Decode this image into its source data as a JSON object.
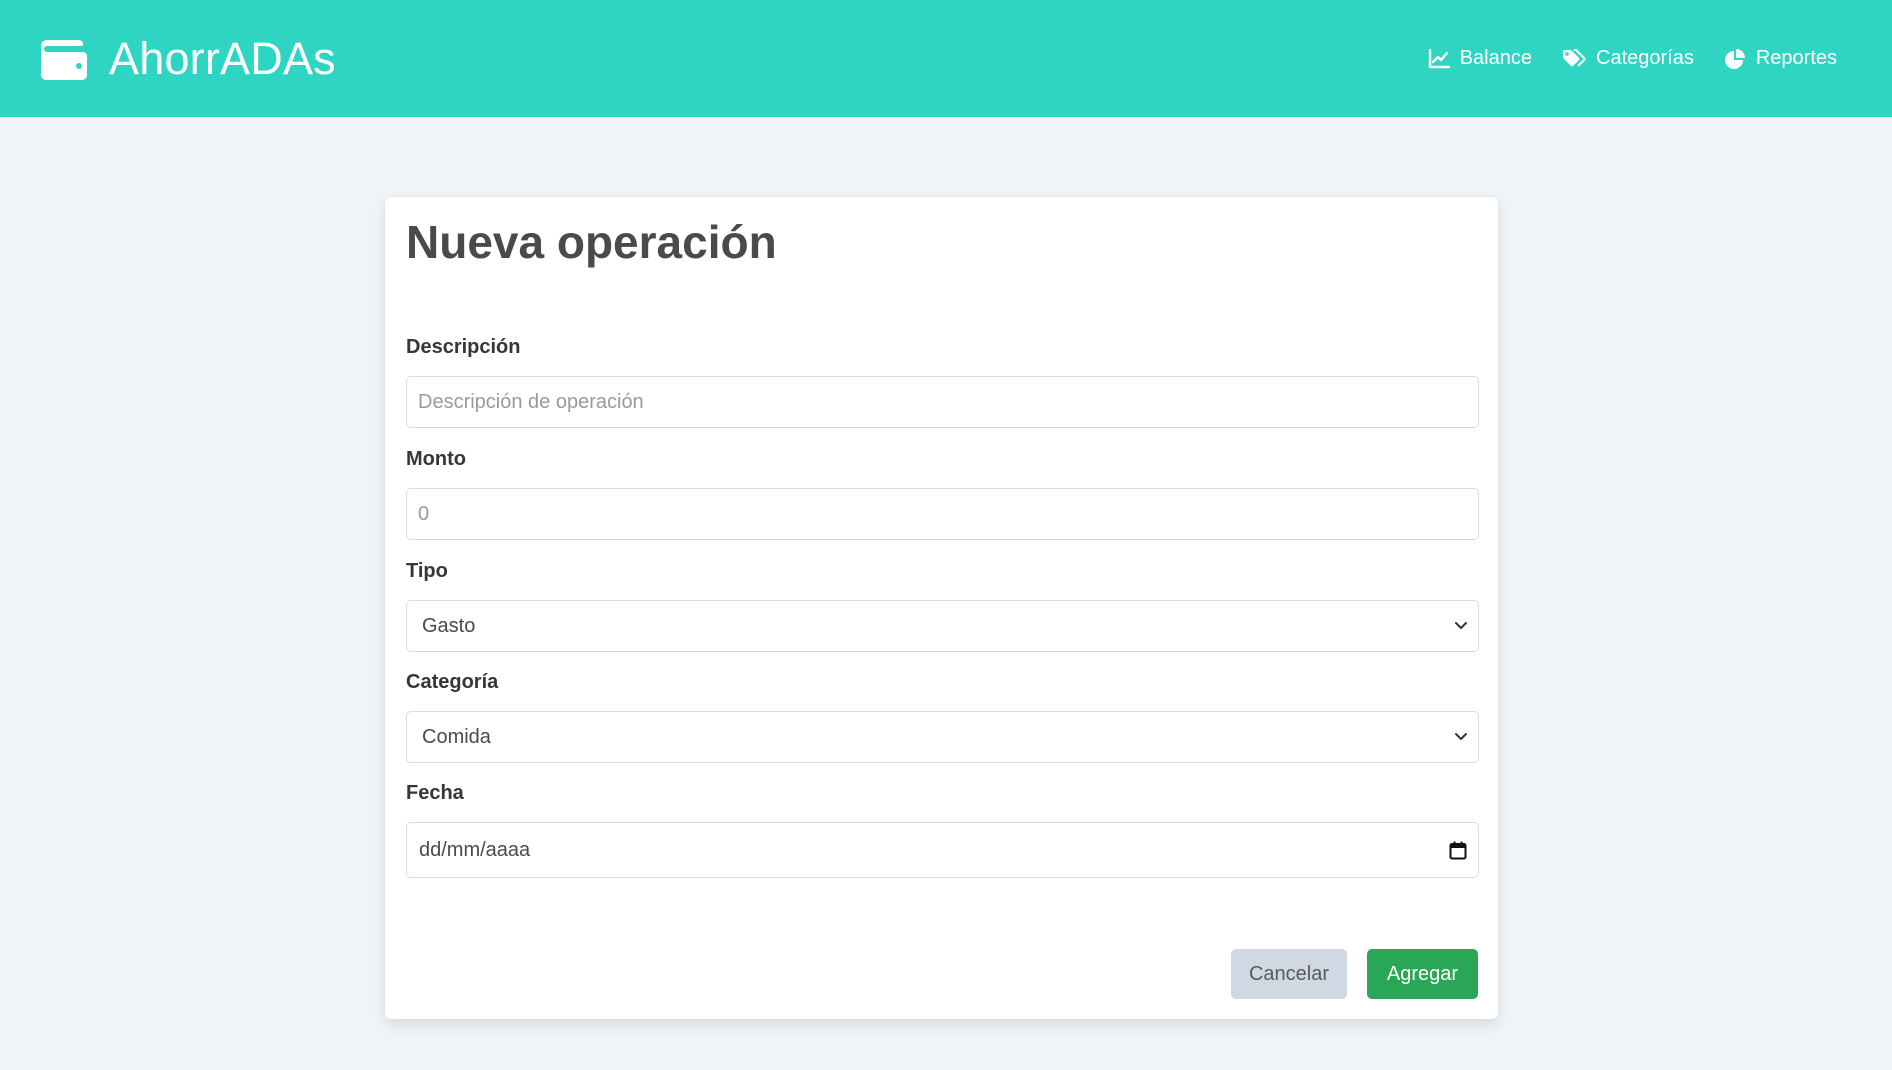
{
  "app": {
    "title": "AhorrADAs",
    "icon": "wallet-icon"
  },
  "nav": {
    "items": [
      {
        "label": "Balance",
        "icon": "chart-line-icon"
      },
      {
        "label": "Categorías",
        "icon": "tags-icon"
      },
      {
        "label": "Reportes",
        "icon": "pie-chart-icon"
      }
    ]
  },
  "form": {
    "title": "Nueva operación",
    "descripcion": {
      "label": "Descripción",
      "placeholder": "Descripción de operación",
      "value": ""
    },
    "monto": {
      "label": "Monto",
      "placeholder": "0",
      "value": ""
    },
    "tipo": {
      "label": "Tipo",
      "selected": "Gasto"
    },
    "categoria": {
      "label": "Categoría",
      "selected": "Comida"
    },
    "fecha": {
      "label": "Fecha",
      "placeholder": "dd/mm/aaaa"
    },
    "cancel_label": "Cancelar",
    "submit_label": "Agregar"
  },
  "colors": {
    "navbar": "#2ed5c2",
    "background": "#f0f4f8",
    "submit": "#2aa756",
    "cancel": "#cfd8e3"
  }
}
